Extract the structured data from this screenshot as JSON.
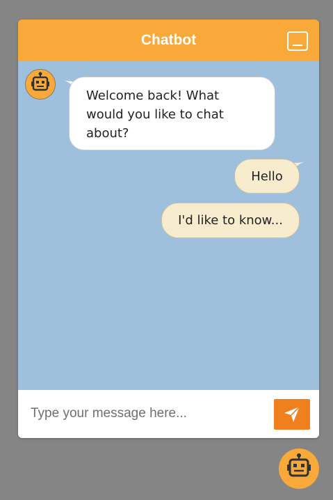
{
  "header": {
    "title": "Chatbot",
    "minimize_icon": "minimize-icon"
  },
  "messages": [
    {
      "sender": "bot",
      "text": "Welcome back! What\nwould you like to chat\nabout?"
    },
    {
      "sender": "user",
      "text": "Hello"
    },
    {
      "sender": "user",
      "text": "I'd like to know..."
    }
  ],
  "input": {
    "value": "",
    "placeholder": "Type your message here..."
  },
  "send_button": {
    "icon": "send-icon"
  },
  "launcher": {
    "icon": "robot-icon"
  },
  "colors": {
    "header": "#f8a93a",
    "chat_background": "#9fc0dc",
    "bot_bubble": "#ffffff",
    "user_bubble": "#f7ecce",
    "send_button": "#f07f1e",
    "page_background": "#858585"
  }
}
